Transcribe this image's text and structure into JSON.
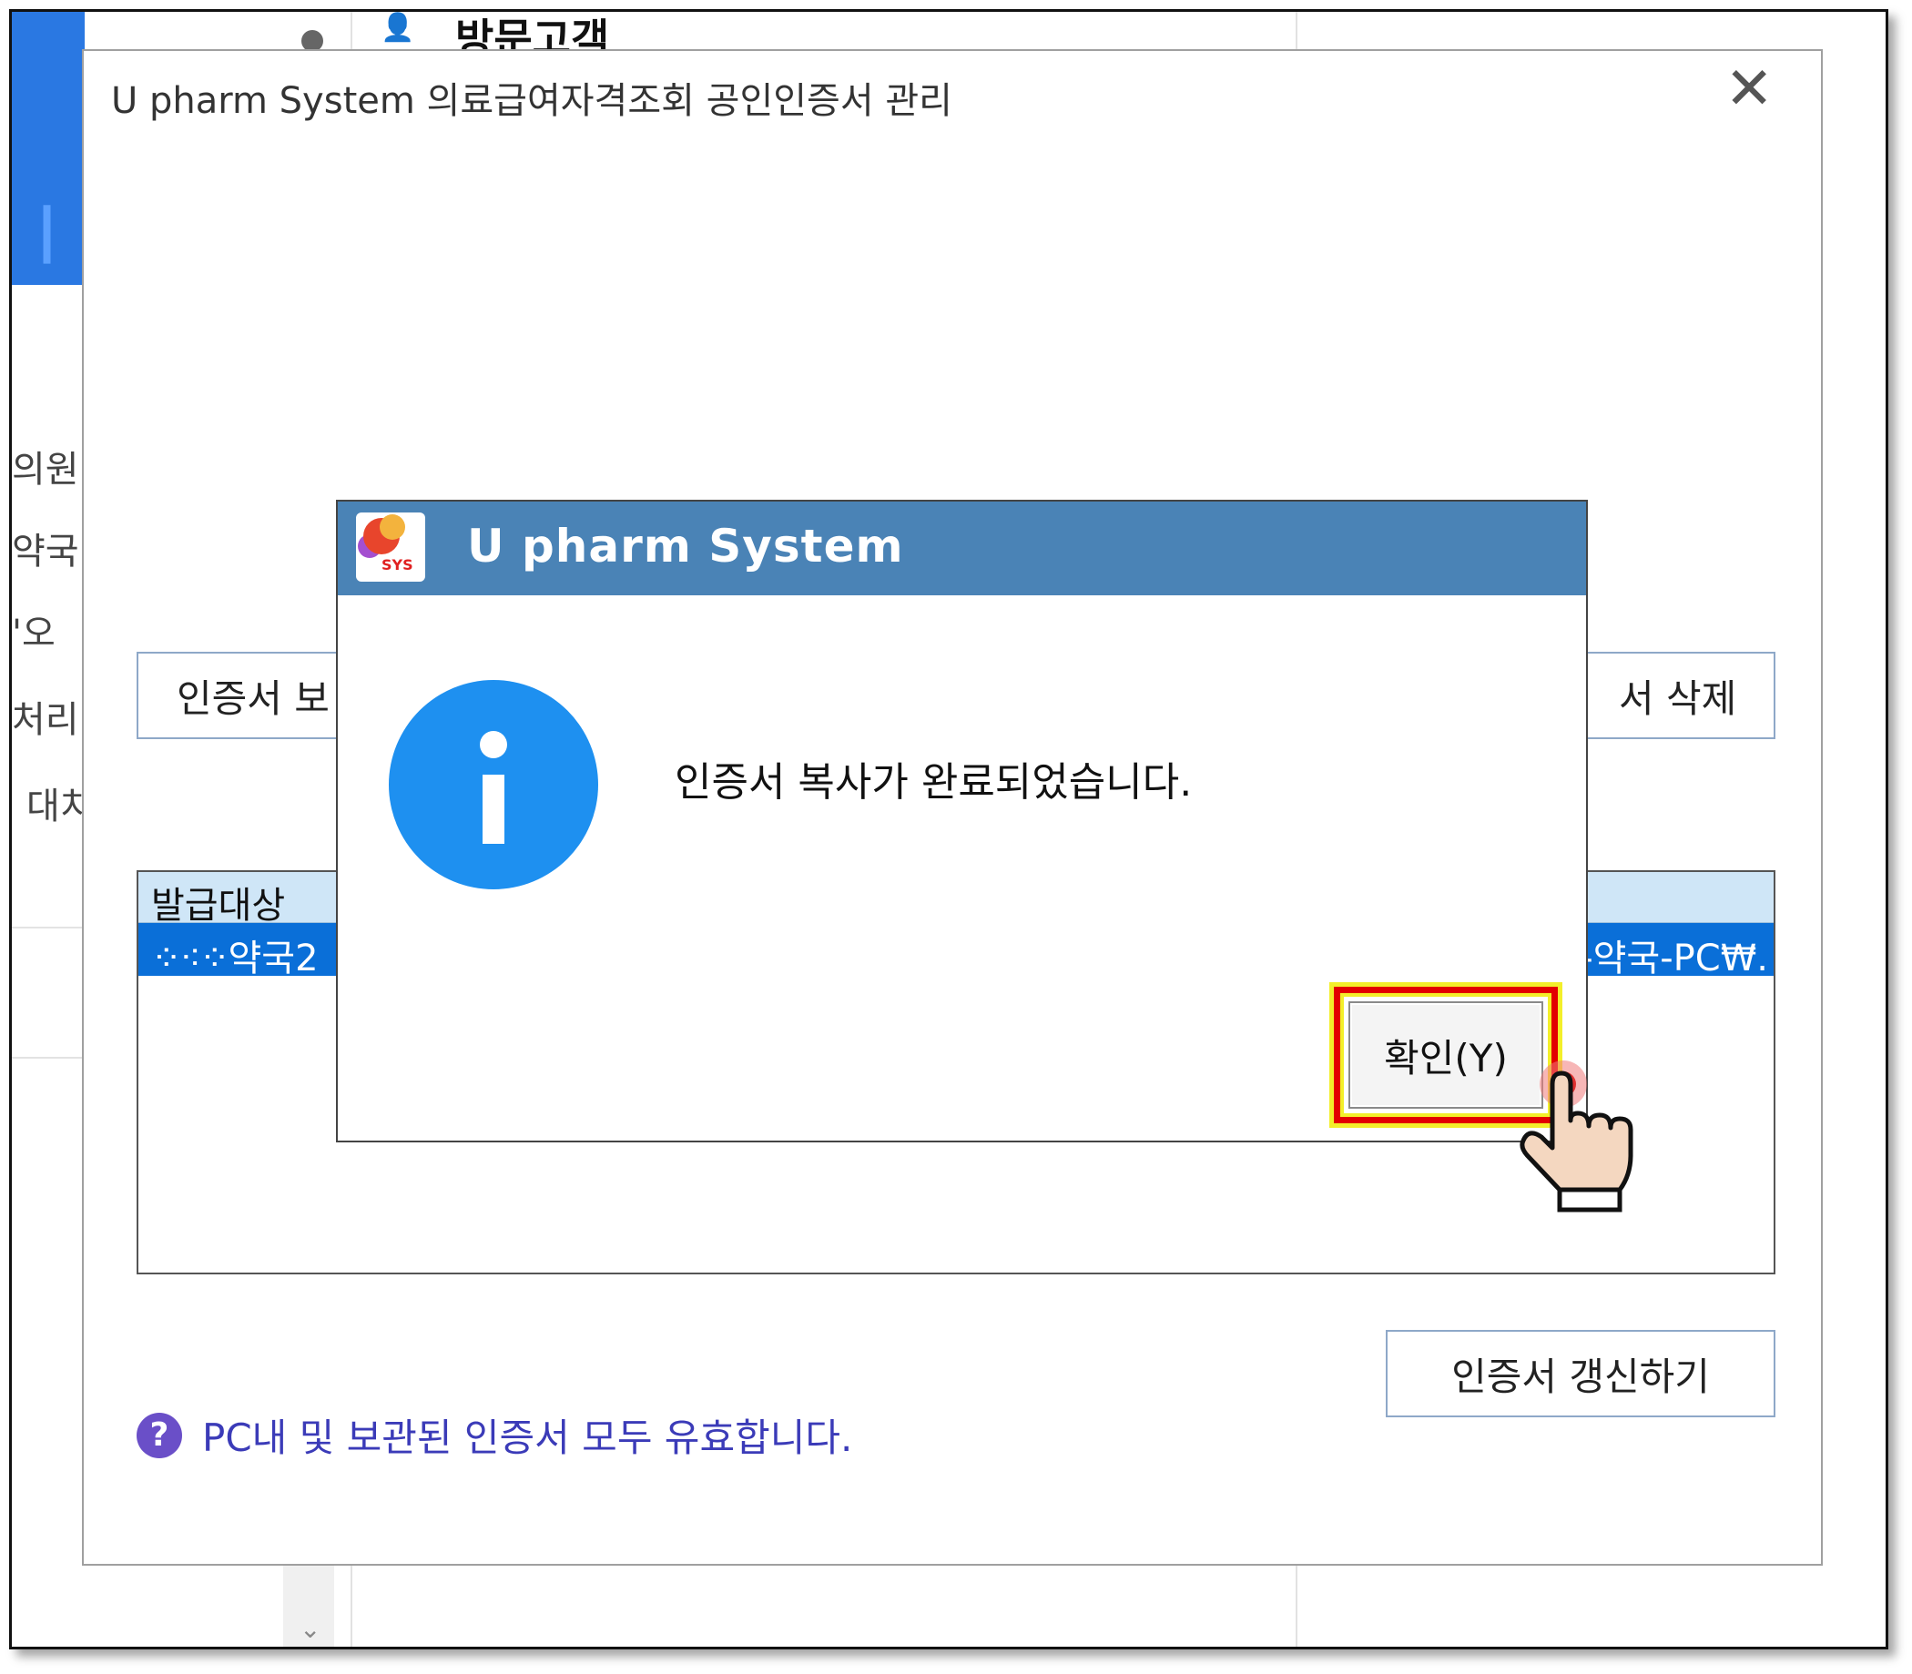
{
  "background": {
    "header_title": "방문고객",
    "left_items": [
      "의원",
      "약국",
      "'오",
      "처리",
      "대치"
    ]
  },
  "main_window": {
    "title": "U pharm System 의료급여자격조회 공인인증서 관리",
    "close_glyph": "✕",
    "buttons": {
      "cert_storage_label": "인증서 보",
      "cert_delete_label": "서 삭제",
      "cert_renew_label": "인증서 갱신하기"
    },
    "list": {
      "header": "발급대상",
      "selected_row": {
        "left": "약국2",
        "right": "-약국-PC₩."
      }
    },
    "help_text": "PC내 및 보관된 인증서 모두 유효합니다."
  },
  "dialog": {
    "title": "U pharm System",
    "app_icon_label": "SYS",
    "message": "인증서 복사가 완료되었습니다.",
    "ok_label": "확인(Y)"
  }
}
